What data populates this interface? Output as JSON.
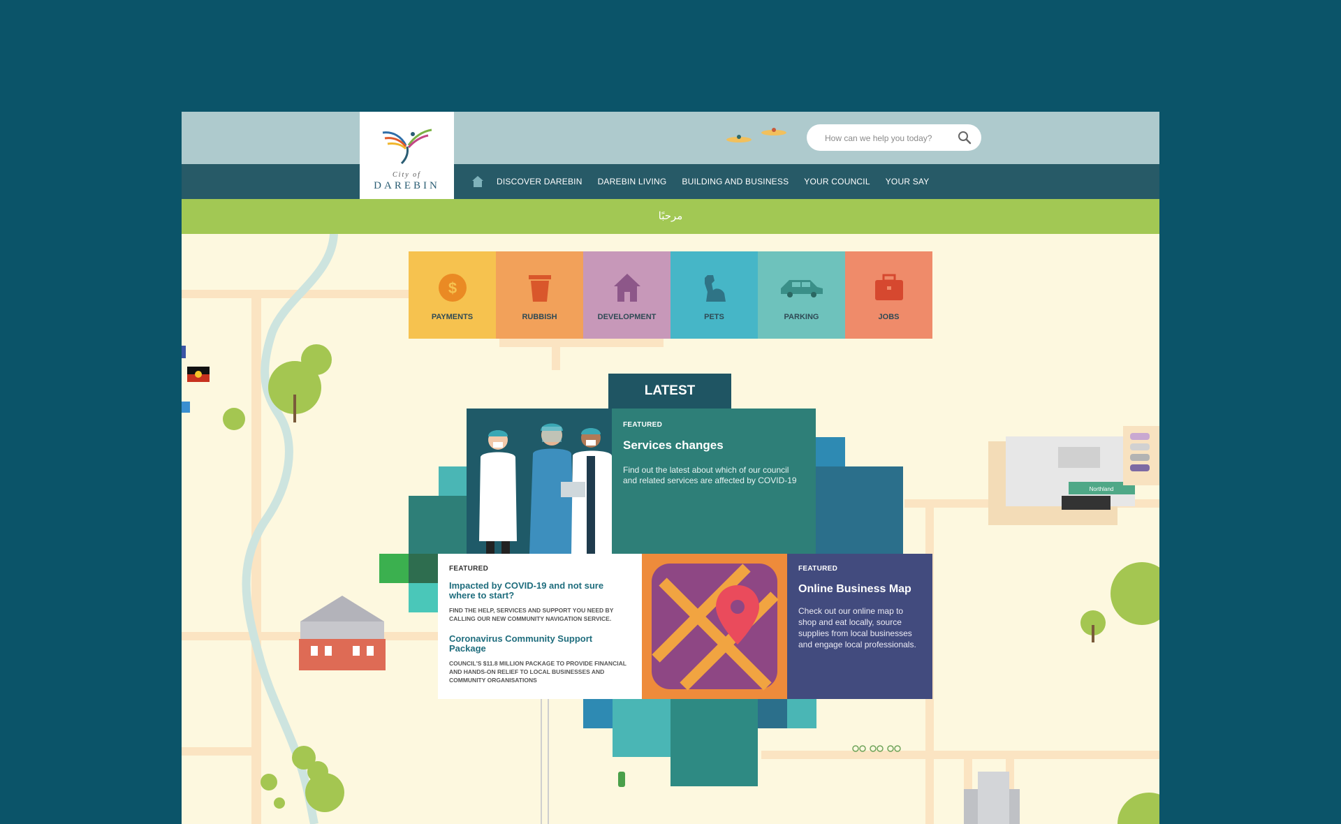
{
  "search": {
    "placeholder": "How can we help you today?"
  },
  "logo": {
    "city": "City of",
    "name": "DAREBIN"
  },
  "nav": {
    "items": [
      {
        "label": "DISCOVER DAREBIN"
      },
      {
        "label": "DAREBIN LIVING"
      },
      {
        "label": "BUILDING AND BUSINESS"
      },
      {
        "label": "YOUR COUNCIL"
      },
      {
        "label": "YOUR SAY"
      }
    ]
  },
  "banner": {
    "greeting": "مرحبًا"
  },
  "tiles": [
    {
      "label": "PAYMENTS",
      "icon": "dollar-coin-icon",
      "color": "#f6c24f"
    },
    {
      "label": "RUBBISH",
      "icon": "bin-icon",
      "color": "#f2a15a"
    },
    {
      "label": "DEVELOPMENT",
      "icon": "house-icon",
      "color": "#c798b9"
    },
    {
      "label": "PETS",
      "icon": "dog-icon",
      "color": "#46b6c7"
    },
    {
      "label": "PARKING",
      "icon": "car-icon",
      "color": "#6ec2bc"
    },
    {
      "label": "JOBS",
      "icon": "briefcase-icon",
      "color": "#ef8b6a"
    }
  ],
  "latest": {
    "heading": "LATEST"
  },
  "card_services": {
    "eyebrow": "FEATURED",
    "title": "Services changes",
    "body": "Find out the latest about which of our council and related services are affected by COVID-19"
  },
  "card_covid": {
    "eyebrow": "FEATURED",
    "item1_title": "Impacted by COVID-19 and not sure where to start?",
    "item1_desc": "FIND THE HELP, SERVICES AND SUPPORT YOU NEED BY CALLING OUR NEW COMMUNITY NAVIGATION SERVICE.",
    "item2_title": "Coronavirus Community Support Package",
    "item2_desc": "COUNCIL'S $11.8 MILLION PACKAGE TO PROVIDE FINANCIAL AND HANDS-ON RELIEF TO LOCAL BUSINESSES AND COMMUNITY ORGANISATIONS"
  },
  "card_map": {
    "eyebrow": "FEATURED",
    "title": "Online Business Map",
    "body": "Check out our online map to shop and eat locally, source supplies from local businesses and engage local professionals."
  },
  "map": {
    "northland_sign": "Northland"
  },
  "colors": {
    "background": "#0b5469",
    "topbar": "#aecacd",
    "nav": "#275a67",
    "banner": "#a2c854",
    "map_base": "#fdf8df"
  }
}
